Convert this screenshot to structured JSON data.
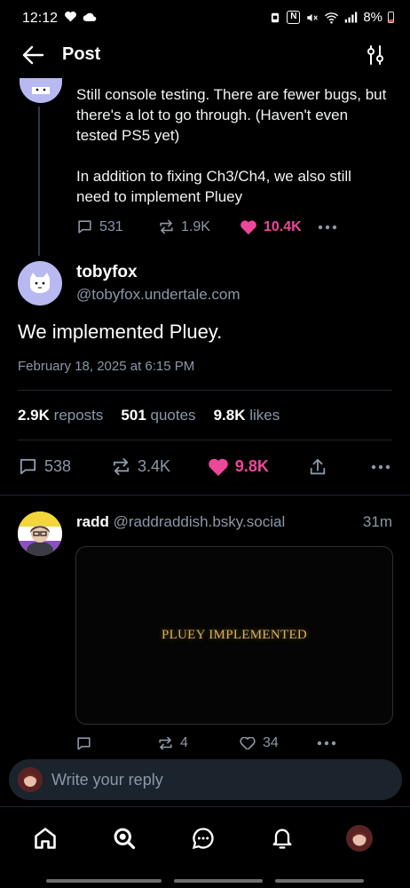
{
  "status_bar": {
    "time": "12:12",
    "battery": "8%",
    "nfc_label": "N"
  },
  "header": {
    "title": "Post"
  },
  "parent_post": {
    "text": "Still console testing. There are fewer bugs, but there's a lot to go through. (Haven't even tested PS5 yet)\n\nIn addition to fixing Ch3/Ch4, we also still need to implement Pluey",
    "replies": "531",
    "reposts": "1.9K",
    "likes": "10.4K",
    "liked": true
  },
  "main_post": {
    "author_name": "tobyfox",
    "author_handle": "@tobyfox.undertale.com",
    "text": "We implemented Pluey.",
    "date": "February 18, 2025 at 6:15 PM",
    "stats": {
      "reposts_count": "2.9K",
      "reposts_label": "reposts",
      "quotes_count": "501",
      "quotes_label": "quotes",
      "likes_count": "9.8K",
      "likes_label": "likes"
    },
    "replies": "538",
    "reposts": "3.4K",
    "likes": "9.8K",
    "liked": true
  },
  "reply_post": {
    "author_name": "radd",
    "author_handle": "@raddraddish.bsky.social",
    "time": "31m",
    "embed_text": "PLUEY IMPLEMENTED",
    "replies": "",
    "reposts": "4",
    "likes": "34"
  },
  "reply_input": {
    "placeholder": "Write your reply"
  },
  "colors": {
    "accent_like": "#ec4899",
    "muted_text": "#8b98a8",
    "background": "#000000"
  },
  "nav": [
    "home-icon",
    "search-icon",
    "chat-icon",
    "bell-icon",
    "profile-avatar"
  ]
}
